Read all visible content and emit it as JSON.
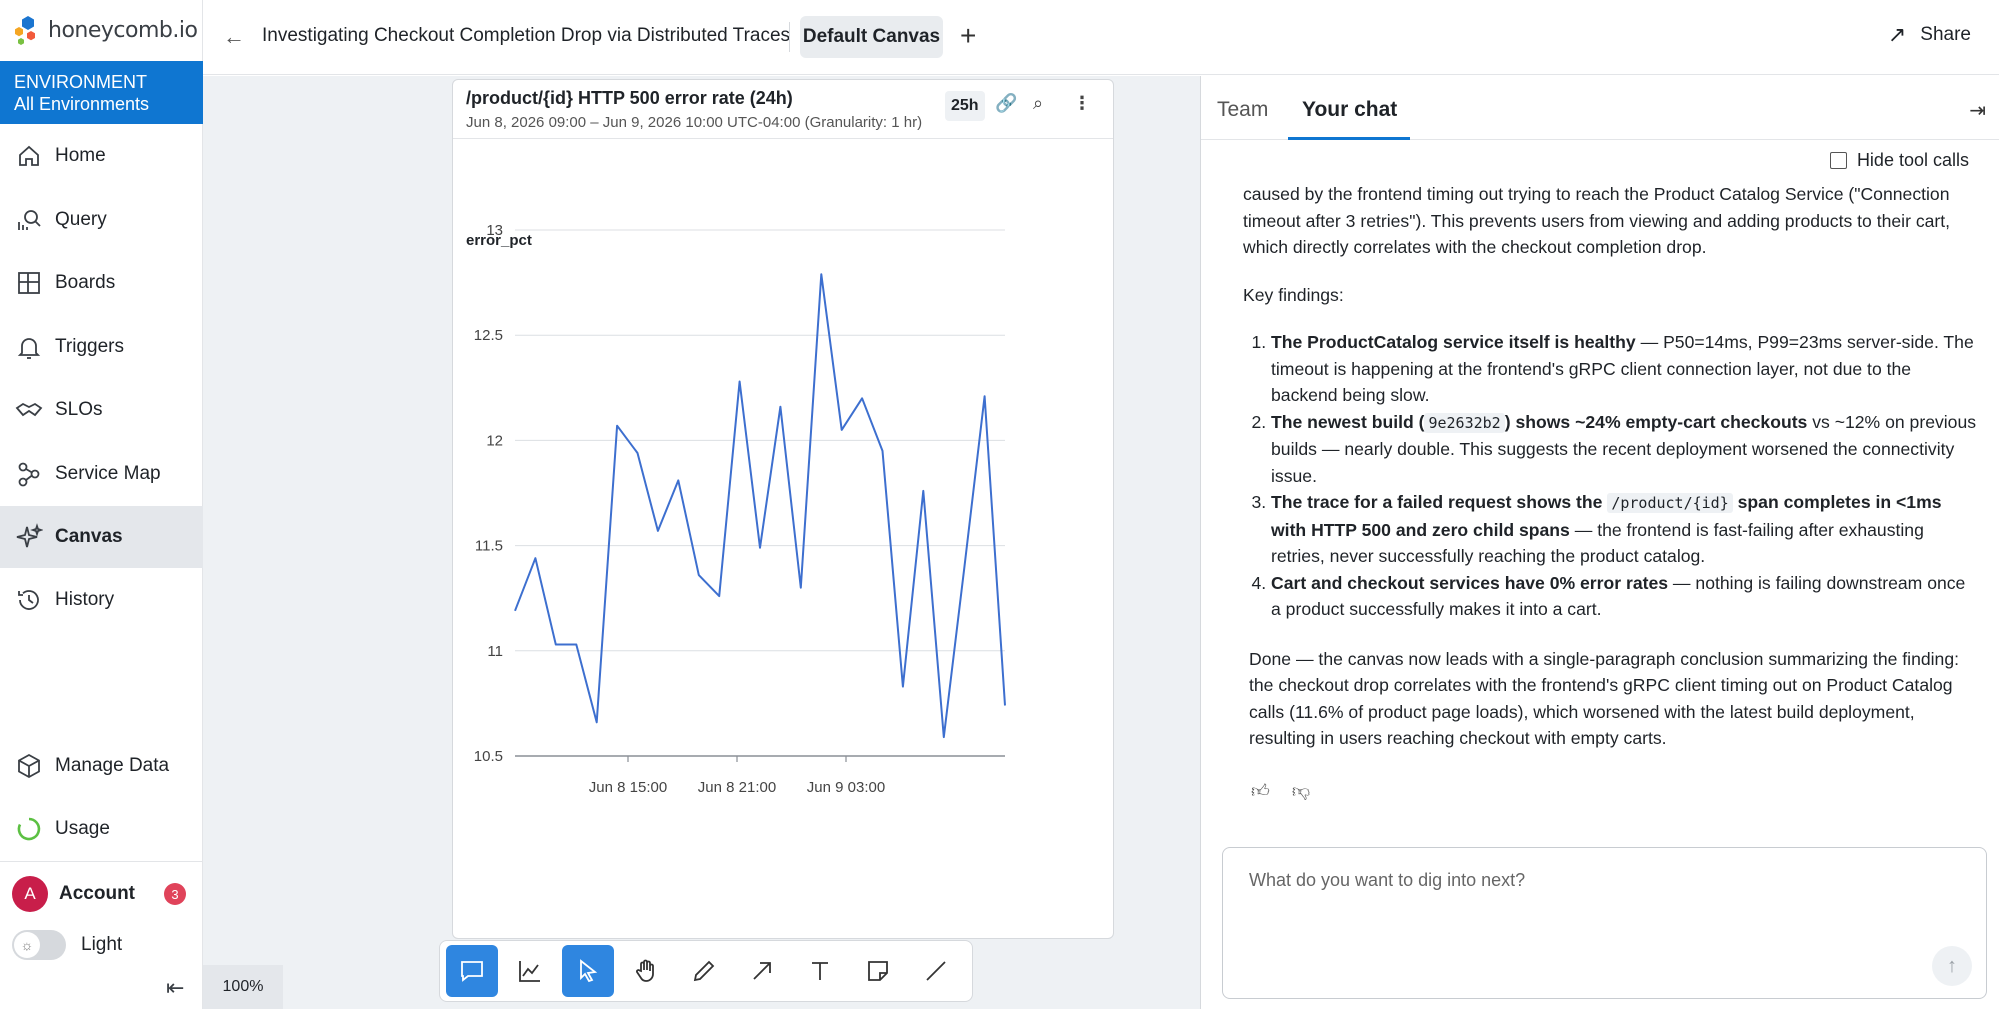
{
  "brand": {
    "logo_text": "honeycomb.io"
  },
  "environment": {
    "label": "ENVIRONMENT",
    "value": "All Environments"
  },
  "nav": {
    "items": [
      {
        "label": "Home",
        "icon": "home-icon"
      },
      {
        "label": "Query",
        "icon": "query-icon"
      },
      {
        "label": "Boards",
        "icon": "boards-icon"
      },
      {
        "label": "Triggers",
        "icon": "bell-icon"
      },
      {
        "label": "SLOs",
        "icon": "handshake-icon"
      },
      {
        "label": "Service Map",
        "icon": "service-map-icon"
      },
      {
        "label": "Canvas",
        "icon": "sparkle-icon",
        "active": true
      },
      {
        "label": "History",
        "icon": "history-icon"
      }
    ],
    "bottom": [
      {
        "label": "Manage Data",
        "icon": "cube-icon"
      },
      {
        "label": "Usage",
        "icon": "usage-icon"
      }
    ]
  },
  "account": {
    "label": "Account",
    "avatar_letter": "A",
    "badge": "3"
  },
  "theme": {
    "label": "Light"
  },
  "topbar": {
    "title": "Investigating Checkout Completion Drop via Distributed Traces",
    "tab": "Default Canvas",
    "share": "Share"
  },
  "card": {
    "title": "/product/{id} HTTP 500 error rate (24h)",
    "subtitle": "Jun 8, 2026 09:00 – Jun 9, 2026 10:00 UTC-04:00 (Granularity: 1 hr)",
    "range": "25h"
  },
  "chart_data": {
    "type": "line",
    "ylabel": "error_pct",
    "ylim": [
      10.5,
      13
    ],
    "yticks": [
      "13",
      "12.5",
      "12",
      "11.5",
      "11"
    ],
    "ytick_bottom": "10.5",
    "xtick_labels": [
      "Jun 8 15:00",
      "Jun 8 21:00",
      "Jun 9 03:00"
    ],
    "xtick_hours": [
      6,
      12,
      18
    ],
    "x_hours_span": 24,
    "series": [
      {
        "color": "#3d6fcf",
        "values": [
          11.19,
          11.44,
          11.03,
          11.03,
          10.66,
          12.07,
          11.94,
          11.57,
          11.81,
          11.36,
          11.26,
          12.28,
          11.49,
          12.16,
          11.3,
          12.79,
          12.05,
          12.2,
          11.95,
          10.83,
          11.76,
          10.59,
          11.39,
          12.21,
          10.74
        ]
      }
    ]
  },
  "zoom": "100%",
  "tools": [
    "comment",
    "chart",
    "select",
    "pan",
    "pen",
    "arrow",
    "text",
    "sticky-note",
    "line"
  ],
  "chat": {
    "tabs": [
      "Team",
      "Your chat"
    ],
    "hide_tool_calls": "Hide tool calls",
    "intro": "caused by the frontend timing out trying to reach the Product Catalog Service (\"Connection timeout after 3 retries\"). This prevents users from viewing and adding products to their cart, which directly correlates with the checkout completion drop.",
    "key_findings": "Key findings:",
    "findings": [
      {
        "bold_a": "The ProductCatalog service itself is healthy",
        "rest": " — P50=14ms, P99=23ms server-side. The timeout is happening at the frontend's gRPC client connection layer, not due to the backend being slow."
      },
      {
        "bold_a": "The newest build (",
        "code": "9e2632b2",
        "bold_b": ") shows ~24% empty-cart checkouts",
        "rest": " vs ~12% on previous builds — nearly double. This suggests the recent deployment worsened the connectivity issue."
      },
      {
        "bold_a": "The trace for a failed request shows the ",
        "code": "/product/{id}",
        "bold_b": " span completes in <1ms with HTTP 500 and zero child spans",
        "rest": " — the frontend is fast-failing after exhausting retries, never successfully reaching the product catalog."
      },
      {
        "bold_a": "Cart and checkout services have 0% error rates",
        "rest": " — nothing is failing downstream once a product successfully makes it into a cart."
      }
    ],
    "conclusion": "Done — the canvas now leads with a single-paragraph conclusion summarizing the finding: the checkout drop correlates with the frontend's gRPC client timing out on Product Catalog calls (11.6% of product page loads), which worsened with the latest build deployment, resulting in users reaching checkout with empty carts.",
    "input_placeholder": "What do you want to dig into next?"
  }
}
